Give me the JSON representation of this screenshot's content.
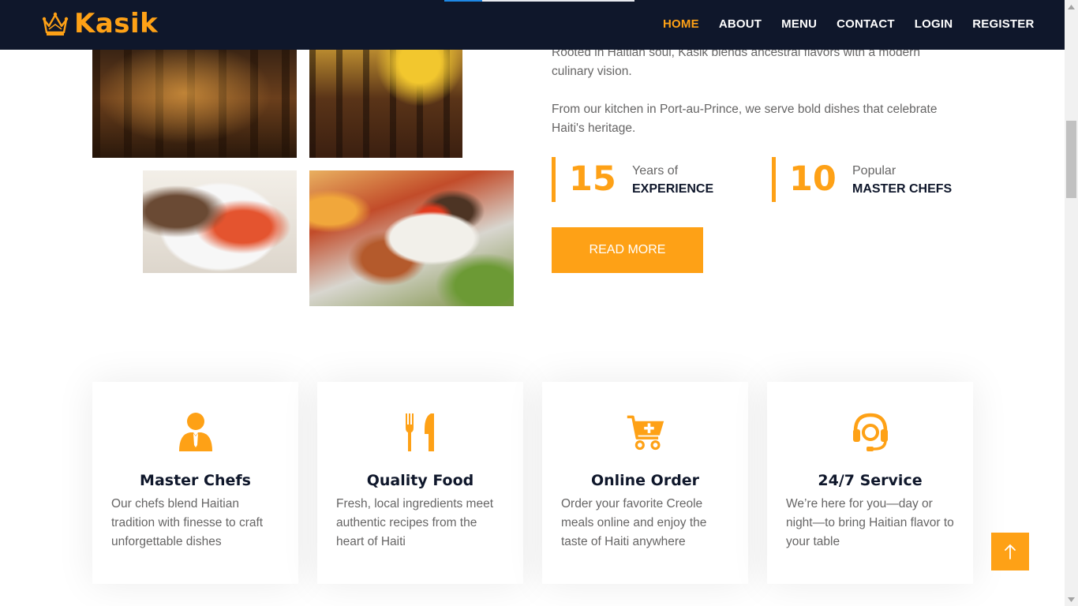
{
  "brand": {
    "name": "Kasik",
    "icon": "crown-icon",
    "accent": "#fea116",
    "navy": "#0f172b"
  },
  "nav": {
    "items": [
      {
        "label": "HOME",
        "active": true
      },
      {
        "label": "ABOUT",
        "active": false
      },
      {
        "label": "MENU",
        "active": false
      },
      {
        "label": "CONTACT",
        "active": false
      },
      {
        "label": "LOGIN",
        "active": false
      },
      {
        "label": "REGISTER",
        "active": false
      }
    ]
  },
  "about": {
    "paragraph_1": "Rooted in Haitian soul, Kasik blends ancestral flavors with a modern culinary vision.",
    "paragraph_2": "From our kitchen in Port-au-Prince, we serve bold dishes that celebrate Haiti's heritage.",
    "stats": [
      {
        "number": "15",
        "caption": "Years of",
        "label": "EXPERIENCE"
      },
      {
        "number": "10",
        "caption": "Popular",
        "label": "MASTER CHEFS"
      }
    ],
    "button_label": "READ MORE"
  },
  "services": [
    {
      "icon": "chef-icon",
      "title": "Master Chefs",
      "description": "Our chefs blend Haitian tradition with finesse to craft unforgettable dishes"
    },
    {
      "icon": "utensils-icon",
      "title": "Quality Food",
      "description": "Fresh, local ingredients meet authentic recipes from the heart of Haiti"
    },
    {
      "icon": "cart-plus-icon",
      "title": "Online Order",
      "description": "Order your favorite Creole meals online and enjoy the taste of Haiti anywhere"
    },
    {
      "icon": "headset-icon",
      "title": "24/7 Service",
      "description": "We’re here for you—day or night—to bring Haitian flavor to your table"
    }
  ],
  "back_to_top": {
    "icon": "arrow-up-icon"
  }
}
